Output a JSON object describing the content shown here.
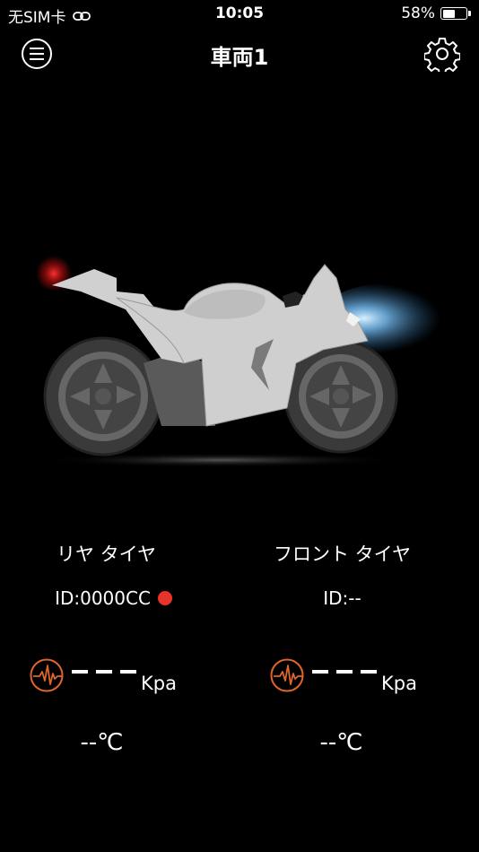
{
  "status_bar": {
    "carrier": "无SIM卡",
    "time": "10:05",
    "battery": "58%",
    "battery_level": 0.58
  },
  "header": {
    "title": "車両1"
  },
  "rear_tire": {
    "name": "リヤ タイヤ",
    "id": "ID:0000CC",
    "pressure_value": "———",
    "pressure_unit": "Kpa",
    "temperature": "--℃",
    "signal_color": "#e8332a"
  },
  "front_tire": {
    "name": "フロント タイヤ",
    "id": "ID:--",
    "pressure_value": "———",
    "pressure_unit": "Kpa",
    "temperature": "--℃"
  },
  "colors": {
    "background": "#000000",
    "accent": "#e0652a",
    "tail_light": "#e02020",
    "head_light": "#7ec8ff"
  }
}
